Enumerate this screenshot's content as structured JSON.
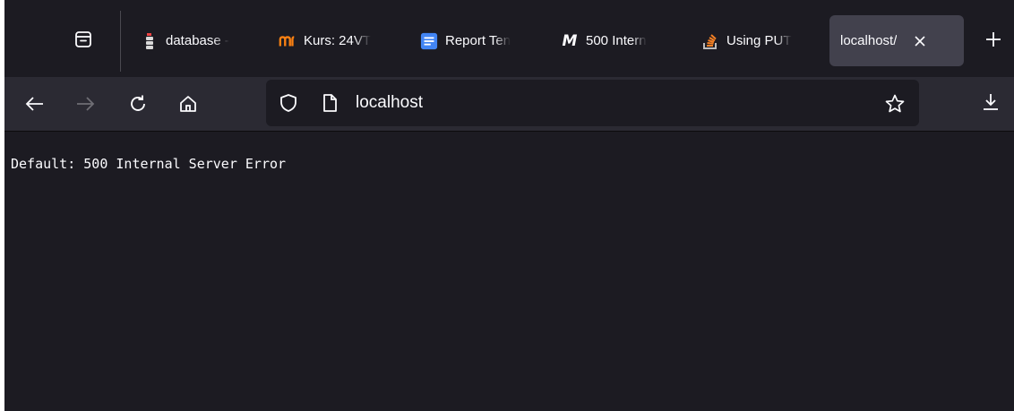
{
  "browser": {
    "tabs": [
      {
        "title": "database -",
        "favicon": "database-favicon",
        "active": false
      },
      {
        "title": "Kurs: 24VT",
        "favicon": "moodle-favicon",
        "active": false
      },
      {
        "title": "Report Ten",
        "favicon": "google-docs-favicon",
        "active": false
      },
      {
        "title": "500 Intern",
        "favicon": "mdn-favicon",
        "active": false
      },
      {
        "title": "Using PUT",
        "favicon": "stackoverflow-favicon",
        "active": false
      },
      {
        "title": "localhost/",
        "favicon": "none",
        "active": true
      }
    ],
    "url": "localhost",
    "icons": {
      "tab_manager": "tab-manager-icon",
      "new_tab": "plus-icon",
      "back": "back-arrow-icon",
      "forward": "forward-arrow-icon",
      "reload": "reload-icon",
      "home": "home-icon",
      "shield": "shield-icon",
      "page": "page-icon",
      "bookmark": "star-icon",
      "downloads": "download-icon",
      "close_tab": "close-icon"
    }
  },
  "page": {
    "body_text": "Default: 500 Internal Server Error"
  },
  "colors": {
    "tabstrip_bg": "#1c1b22",
    "navbar_bg": "#2b2a33",
    "active_tab_bg": "#42414d",
    "content_bg": "#1c1b22",
    "text": "#fbfbfe",
    "docs_blue": "#4285f4",
    "moodle_orange": "#f98012",
    "stackoverflow_orange": "#f48024"
  }
}
